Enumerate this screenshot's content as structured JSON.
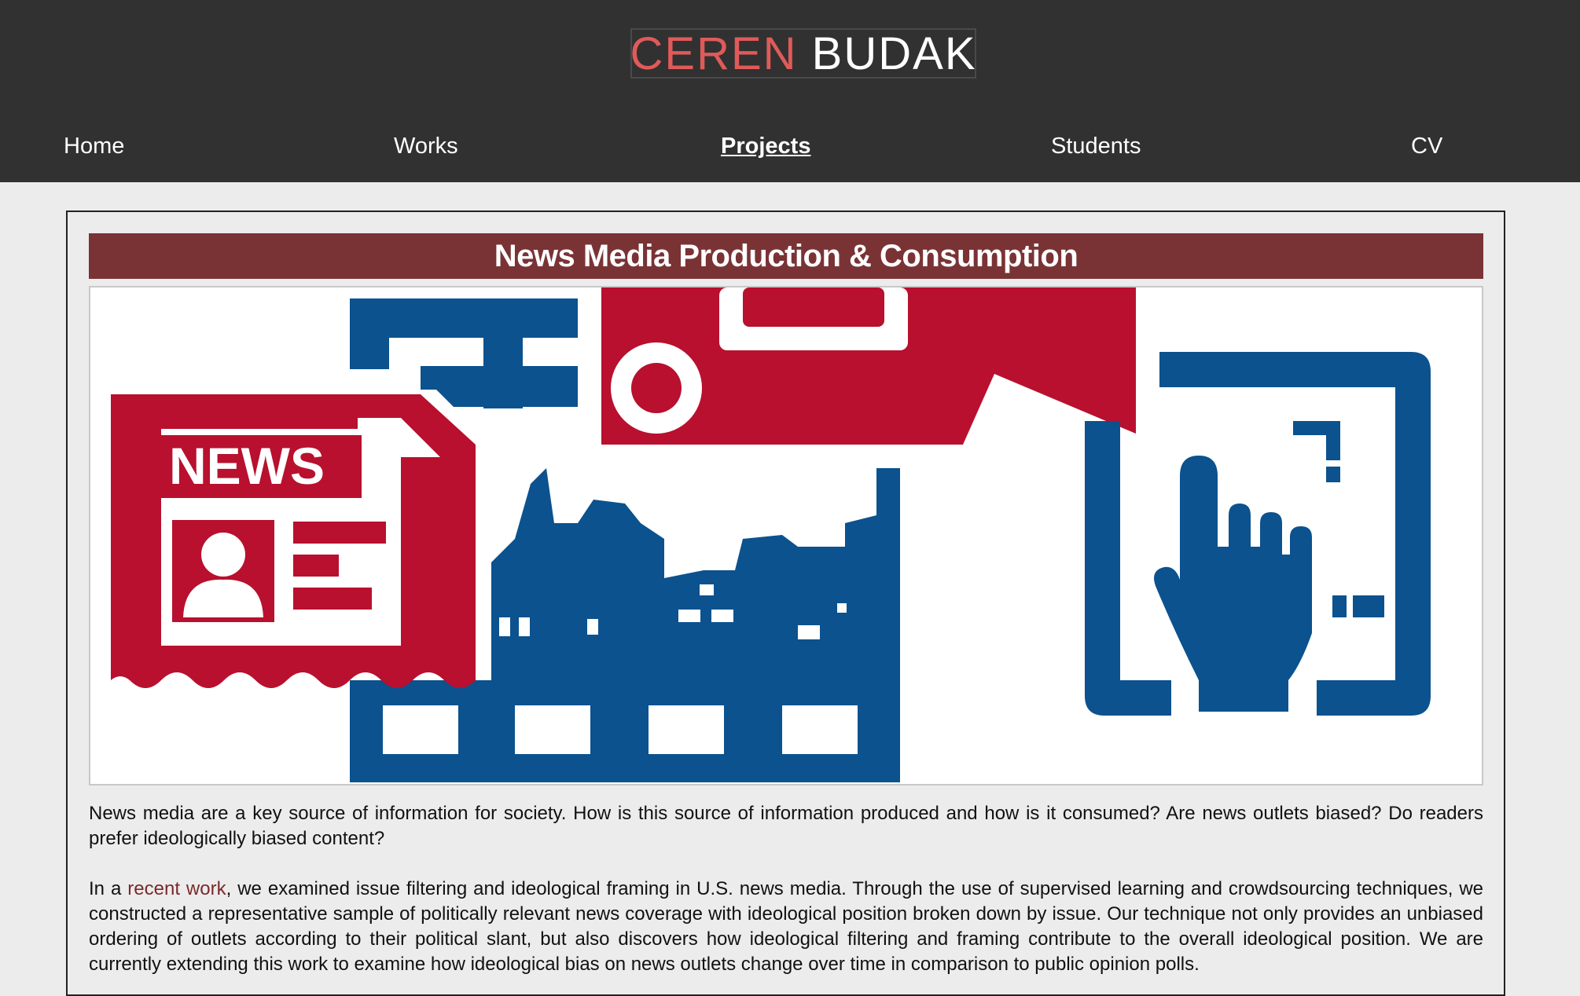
{
  "site": {
    "name_first": "CEREN",
    "name_last": "BUDAK"
  },
  "nav": {
    "home": "Home",
    "works": "Works",
    "projects": "Projects",
    "students": "Students",
    "cv": "CV"
  },
  "project": {
    "title": "News Media Production & Consumption",
    "image_news_label": "NEWS",
    "paragraph1": "News media are a key source of information for society. How is this source of information produced and how is it consumed? Are news outlets biased? Do readers prefer ideologically biased content?",
    "paragraph2_prefix": "In a ",
    "paragraph2_link": "recent work",
    "paragraph2_suffix": ", we examined issue filtering and ideological framing in U.S. news media. Through the use of supervised learning and crowdsourcing techniques, we constructed a representative sample of politically relevant news coverage with ideological position broken down by issue. Our technique not only provides an unbiased ordering of outlets according to their political slant, but also discovers how ideological filtering and framing contribute to the overall ideological position. We are currently extending this work to examine how ideological bias on news outlets change over time in comparison to public opinion polls."
  },
  "colors": {
    "header_bg": "#313131",
    "accent": "#e05a5a",
    "title_bar": "#7a3335",
    "illustration_red": "#b8102e",
    "illustration_blue": "#0b528e"
  }
}
